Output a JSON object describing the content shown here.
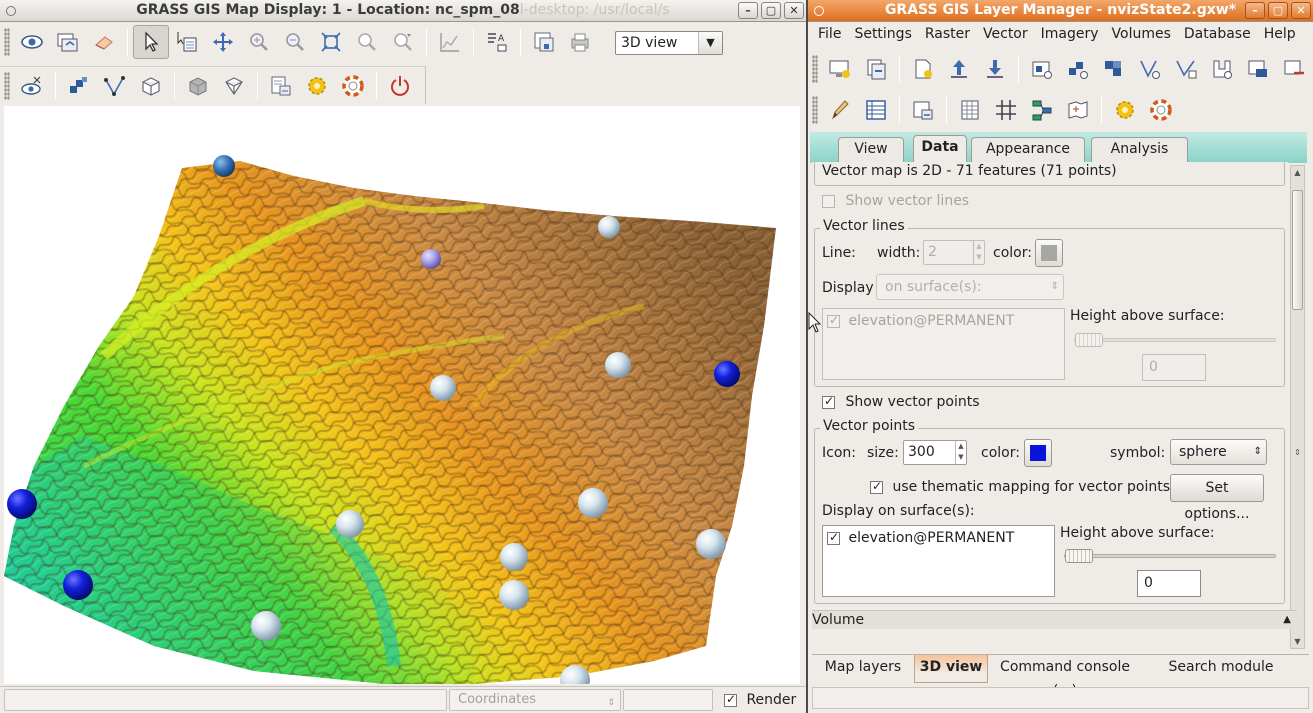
{
  "map_display": {
    "title": "GRASS GIS Map Display: 1  - Location: nc_spm_08",
    "title_overflow": "l-desktop: /usr/local/s",
    "view_mode": "3D view",
    "status": {
      "coordinates_placeholder": "Coordinates",
      "render_label": "Render",
      "render_checked": true
    },
    "toolbar_icons": [
      "display-icon",
      "render-icon",
      "erase-icon",
      "pointer-icon",
      "query-icon",
      "pan-icon",
      "zoom-in-icon",
      "zoom-out-icon",
      "zoom-extent-icon",
      "zoom-back-icon",
      "zoom-menu-icon",
      "analyze-icon",
      "overlay-icon",
      "save-image-icon",
      "print-icon"
    ],
    "nviz_toolbar_icons": [
      "view-icon",
      "surface-icon",
      "vector-icon",
      "volume-icon",
      "light-icon",
      "fringe-icon",
      "animation-icon",
      "settings-icon",
      "help-icon",
      "quit-icon"
    ]
  },
  "layer_manager": {
    "title": "GRASS GIS Layer Manager - nvizState2.gxw*",
    "menu": [
      "File",
      "Settings",
      "Raster",
      "Vector",
      "Imagery",
      "Volumes",
      "Database",
      "Help"
    ],
    "tabs": [
      "View",
      "Data",
      "Appearance",
      "Analysis"
    ],
    "active_tab": "Data",
    "summary": "Vector map is 2D - 71 features (71 points)",
    "show_vector_lines": {
      "label": "Show vector lines",
      "checked": false
    },
    "vector_lines": {
      "title": "Vector lines",
      "line_label": "Line:",
      "width_label": "width:",
      "width_value": "2",
      "color_label": "color:",
      "color": "#a8a6a2",
      "display_label": "Display",
      "display_value": "on surface(s):",
      "surface_item": "elevation@PERMANENT",
      "height_label": "Height above surface:",
      "height_value": "0"
    },
    "show_vector_points": {
      "label": "Show vector points",
      "checked": true
    },
    "vector_points": {
      "title": "Vector points",
      "icon_label": "Icon:",
      "size_label": "size:",
      "size_value": "300",
      "color_label": "color:",
      "color": "#0a14d8",
      "symbol_label": "symbol:",
      "symbol_value": "sphere",
      "thematic_label": "use thematic mapping for vector points",
      "thematic_checked": true,
      "set_options_label": "Set options...",
      "display_on_label": "Display on surface(s):",
      "surface_item": "elevation@PERMANENT",
      "height_label": "Height above surface:",
      "height_value": "0"
    },
    "volume_label": "Volume",
    "bottom_tabs": [
      "Map layers",
      "3D view",
      "Command console (...)",
      "Search module"
    ],
    "active_bottom_tab": "3D view"
  }
}
